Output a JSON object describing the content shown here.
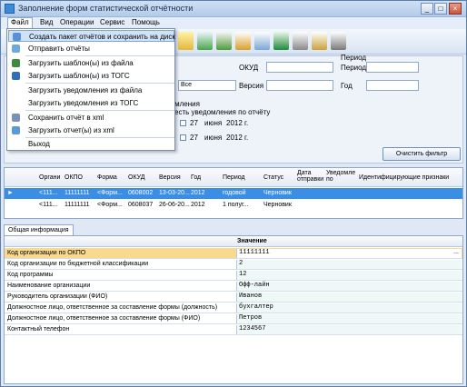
{
  "window": {
    "title": "Заполнение форм статистической отчётности",
    "btn_min": "_",
    "btn_max": "□",
    "btn_close": "×"
  },
  "menubar": {
    "file": "Файл",
    "view": "Вид",
    "operations": "Операции",
    "service": "Сервис",
    "help": "Помощь"
  },
  "file_menu": [
    "Создать пакет отчётов и сохранить на диск",
    "Отправить отчёты",
    "Загрузить шаблон(ы) из файла",
    "Загрузить шаблон(ы) из ТОГС",
    "Загрузить уведомления из файла",
    "Загрузить уведомления из ТОГС",
    "Сохранить отчёт в xml",
    "Загрузить отчет(ы) из xml",
    "Выход"
  ],
  "filter": {
    "okud_label": "ОКУД",
    "version_label": "Версия",
    "period_group": "Период",
    "period_label": "Период",
    "year_label": "Год",
    "all_value": "Все",
    "notif_label": "домления",
    "notif_exists": "есть уведомления по отчёту",
    "date1": {
      "day": "27",
      "month": "июня",
      "year": "2012 г."
    },
    "date2": {
      "day": "27",
      "month": "июня",
      "year": "2012 г."
    },
    "clear_button": "Очистить фильтр"
  },
  "grid": {
    "headers": [
      "Органи",
      "ОКПО",
      "Форма",
      "ОКУД",
      "Версия",
      "Год",
      "Период",
      "Статус",
      "Дата отправки",
      "Уведомле по",
      "Идентифицирующие признаки"
    ],
    "rows": [
      {
        "org": "<111...",
        "okpo": "11111111",
        "form": "<Форм...",
        "okud": "0608002",
        "version": "13-03-20...",
        "year": "2012",
        "period": "годовой",
        "status": "Черновик"
      },
      {
        "org": "<111...",
        "okpo": "11111111",
        "form": "<Форм...",
        "okud": "0608037",
        "version": "26-06-20...",
        "year": "2012",
        "period": "1 полуг...",
        "status": "Черновик"
      }
    ]
  },
  "tab_general": "Общая информация",
  "props": {
    "value_header": "Значение",
    "ellipsis": "...",
    "rows": [
      {
        "key": "Код организации по ОКПО",
        "value": "11111111"
      },
      {
        "key": "Код организации по бюджетной классификации",
        "value": "2"
      },
      {
        "key": "Код программы",
        "value": "12"
      },
      {
        "key": "Наименование организации",
        "value": "Офф-лайн"
      },
      {
        "key": "Руководитель организации (ФИО)",
        "value": "Иванов"
      },
      {
        "key": "Должностное лицо, ответственное за составление формы (должность)",
        "value": "бухгалтер"
      },
      {
        "key": "Должностное лицо, ответственное за составление формы (ФИО)",
        "value": "Петров"
      },
      {
        "key": "Контактный телефон",
        "value": "1234567"
      }
    ]
  },
  "colors": {
    "selection": "#3a8ee6",
    "highlight": "#f8d98e",
    "accent": "#1f5fa8"
  }
}
